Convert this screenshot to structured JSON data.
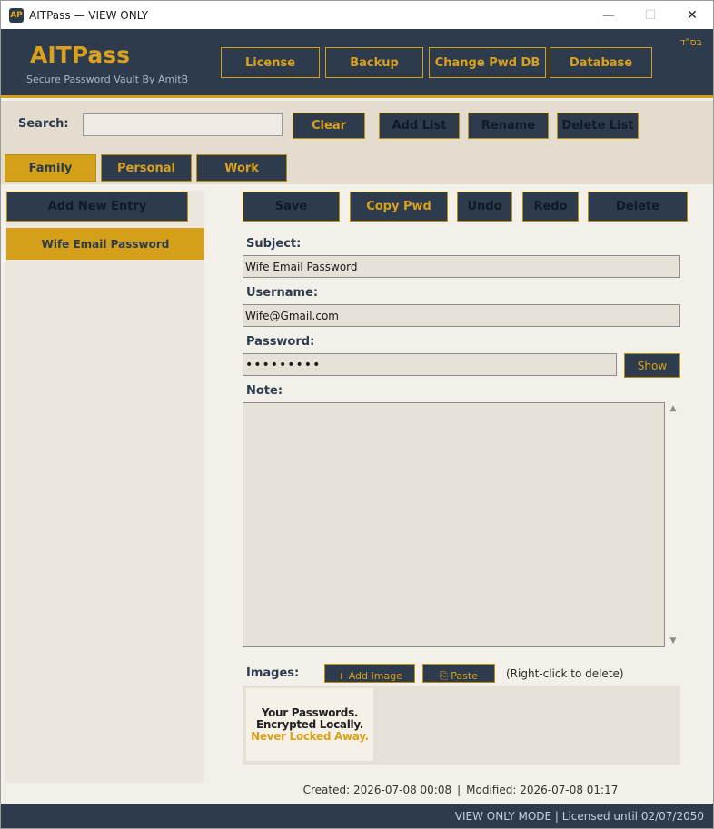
{
  "window": {
    "title": "AITPass — VIEW ONLY",
    "icon_text": "AP",
    "controls": {
      "minimize": "—",
      "maximize": "☐",
      "close": "✕"
    }
  },
  "header": {
    "app_name": "AITPass",
    "subtitle": "Secure Password Vault By AmitB",
    "bsd": "בס\"ד",
    "buttons": {
      "license": "License",
      "backup": "Backup",
      "change_pwd_db": "Change Pwd DB",
      "database": "Database"
    }
  },
  "toolbar": {
    "search_label": "Search:",
    "search_value": "",
    "clear": "Clear",
    "add_list": "Add List",
    "rename": "Rename",
    "delete_list": "Delete List"
  },
  "tabs": [
    {
      "label": "Family",
      "active": true
    },
    {
      "label": "Personal",
      "active": false
    },
    {
      "label": "Work",
      "active": false
    }
  ],
  "left": {
    "add_entry": "Add New Entry",
    "entries": [
      {
        "label": "Wife Email Password",
        "selected": true
      }
    ]
  },
  "actions": {
    "save": "Save",
    "copy_pwd": "Copy Pwd",
    "undo": "Undo",
    "redo": "Redo",
    "delete": "Delete"
  },
  "form": {
    "subject_label": "Subject:",
    "subject_value": "Wife Email Password",
    "username_label": "Username:",
    "username_value": "Wife@Gmail.com",
    "password_label": "Password:",
    "password_value": "•••••••••",
    "show": "Show",
    "note_label": "Note:",
    "note_value": ""
  },
  "images": {
    "label": "Images:",
    "add_image": "+ Add Image",
    "paste": "⎘ Paste",
    "hint": "(Right-click to delete)",
    "thumb_lines": [
      "Your Passwords.",
      "Encrypted Locally.",
      "Never Locked Away."
    ]
  },
  "meta": {
    "created": "Created: 2026-07-08 00:08",
    "separator": "|",
    "modified": "Modified: 2026-07-08 01:17"
  },
  "status": {
    "text": "VIEW ONLY MODE  |  Licensed until 02/07/2050"
  },
  "colors": {
    "navy": "#2d3b4d",
    "gold": "#d4a019",
    "background": "#f3f0ea"
  }
}
